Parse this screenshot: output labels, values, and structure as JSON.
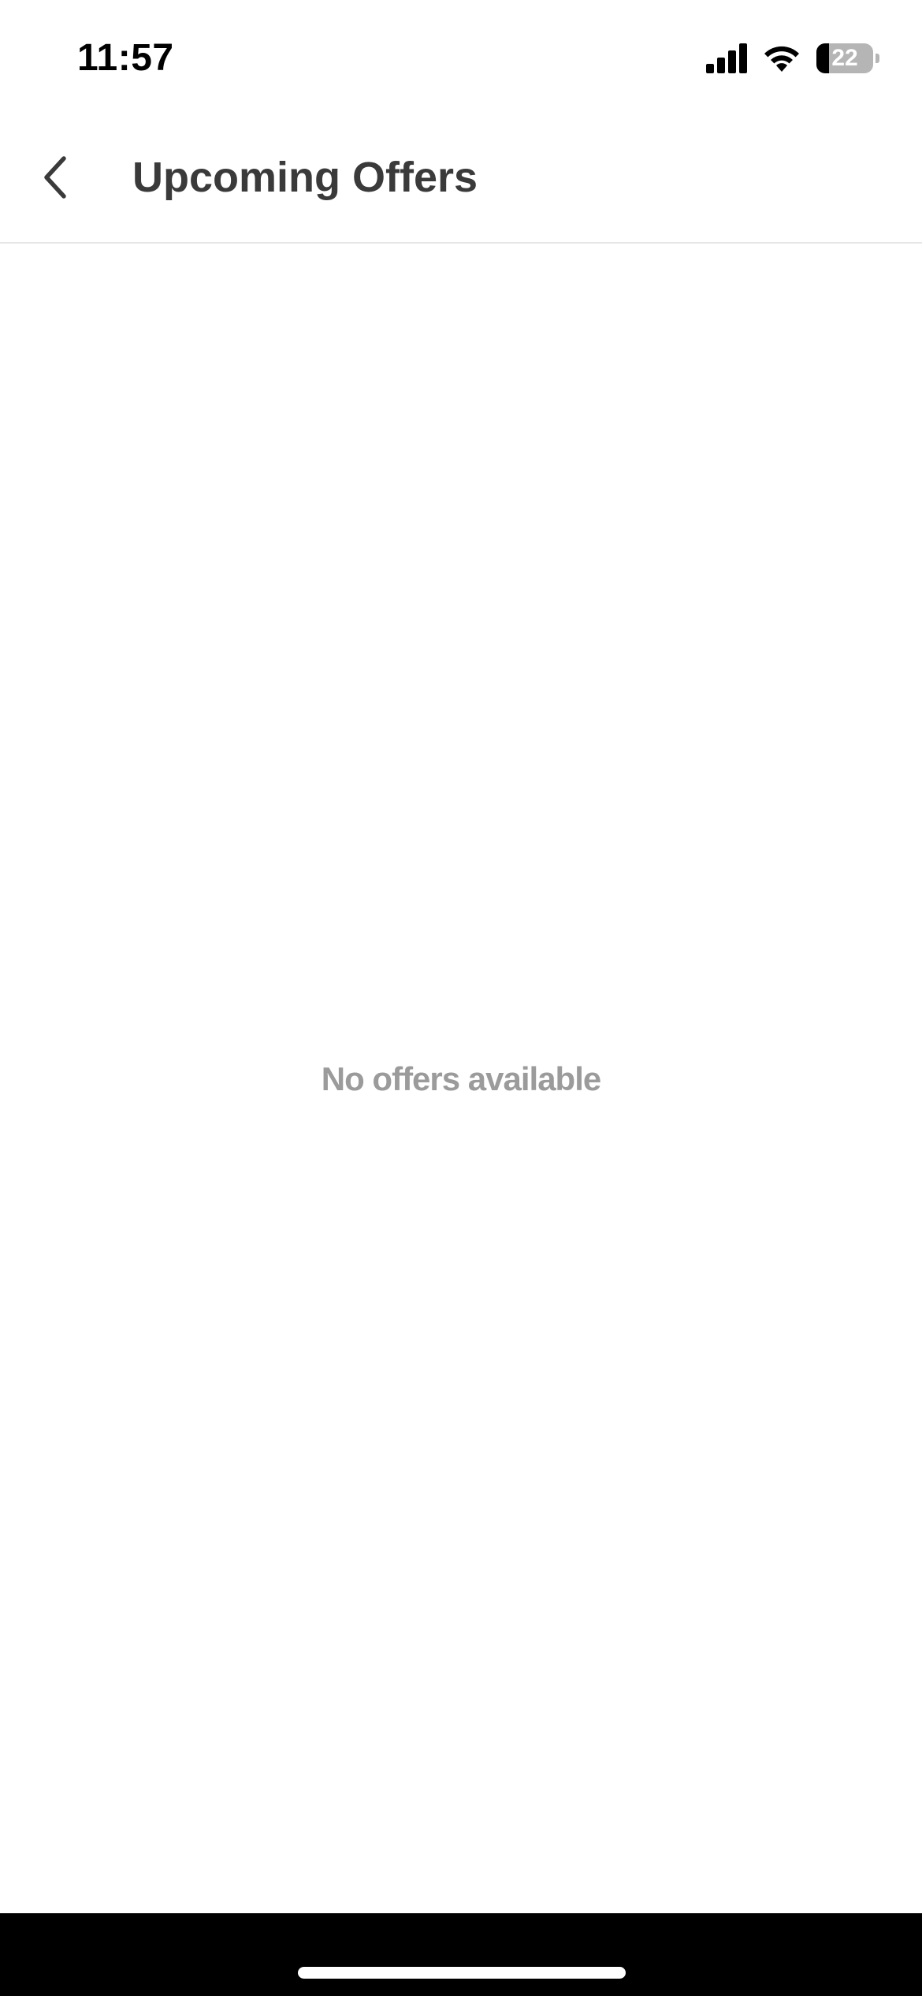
{
  "status_bar": {
    "time": "11:57",
    "battery_percent": "22",
    "icons": [
      "signal-icon",
      "wifi-icon",
      "battery-icon"
    ]
  },
  "header": {
    "title": "Upcoming Offers",
    "back_icon": "chevron-left-icon"
  },
  "main": {
    "empty_message": "No offers available"
  },
  "colors": {
    "title": "#3a3a3a",
    "empty_text": "#9b9b9b",
    "divider": "#e6e6e6",
    "background": "#ffffff"
  }
}
